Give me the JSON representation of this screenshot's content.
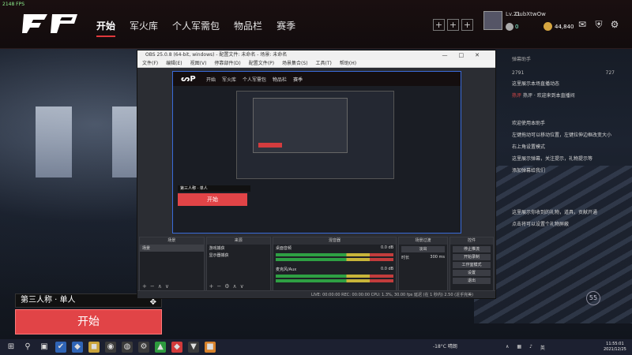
{
  "fps_text": "2148 FPS",
  "nav": {
    "tabs": [
      "开始",
      "军火库",
      "个人军需包",
      "物品栏",
      "赛季"
    ],
    "active": "开始"
  },
  "user": {
    "level": "Lv.21",
    "name": "GubXtwOw",
    "currency1": "0",
    "currency2": "44,840"
  },
  "top_icons": [
    "plus-icon",
    "plus-icon",
    "plus-icon",
    "mail-icon",
    "shield-icon",
    "gear-icon"
  ],
  "chat": {
    "title": "弹幕助手",
    "stats": [
      "2791",
      "727"
    ],
    "lines": [
      "这里展示本场直播动态",
      "热评 · 欢迎来到本直播间",
      "欢迎使用本助手",
      "左键拖动可以移动位置，左键拉伸边框改变大小",
      "右上角设置模式",
      "这里展示弹幕，关注提示，礼物提示等",
      "添加弹幕给我们",
      "这里展示你收到的礼物，道具，贡献开通",
      "点击将可以设置个礼物屏蔽"
    ],
    "hot_tag": "热评"
  },
  "game": {
    "mode_label": "第三人称 · 单人",
    "start_label": "开始",
    "badge": "55"
  },
  "obs": {
    "title": "OBS 25.0.8 (64-bit, windows) - 配置文件: 未命名 - 场景: 未命名",
    "menu": [
      "文件(F)",
      "编辑(E)",
      "视图(V)",
      "停靠部件(D)",
      "配置文件(P)",
      "场景集合(S)",
      "工具(T)",
      "帮助(H)"
    ],
    "preview": {
      "tabs": [
        "开始",
        "军火库",
        "个人军需包",
        "物品栏",
        "赛季"
      ],
      "mode_label": "第三人称 · 单人",
      "start_label": "开始"
    },
    "docks": {
      "scenes": {
        "title": "场景",
        "items": [
          "场景"
        ]
      },
      "sources": {
        "title": "来源",
        "items": [
          "游戏捕获",
          "显示器捕获"
        ]
      },
      "mixer": {
        "title": "混音器",
        "channels": [
          {
            "name": "桌面音频",
            "db": "0.0 dB"
          },
          {
            "name": "麦克风/Aux",
            "db": "0.0 dB"
          }
        ]
      },
      "transitions": {
        "title": "场景过渡",
        "type": "淡出",
        "duration_label": "时长",
        "duration": "300 ms"
      },
      "controls": {
        "title": "控件",
        "buttons": [
          "停止推流",
          "开始录制",
          "工作室模式",
          "设置",
          "退出"
        ]
      }
    },
    "status": "LIVE: 00:00:00   REC: 00:00:00   CPU: 1.3%, 30.00 fps   延迟 (在 1 秒内) 2.50 (近乎完美)"
  },
  "taskbar": {
    "weather": "-18°C 晴朗",
    "ime": "英",
    "time": "11:55:01",
    "date": "2021/12/25"
  }
}
